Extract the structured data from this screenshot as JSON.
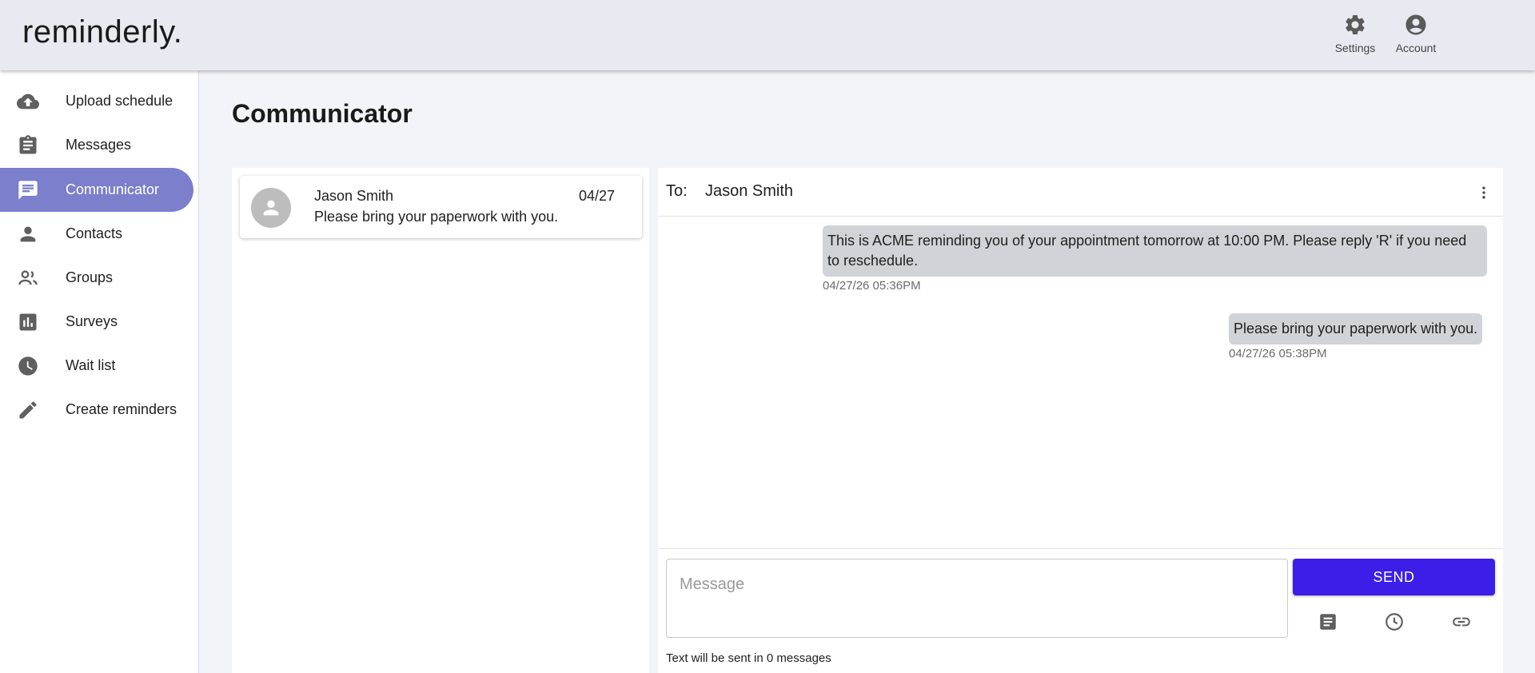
{
  "app": {
    "logo": "reminderly."
  },
  "header": {
    "settings_label": "Settings",
    "account_label": "Account"
  },
  "sidebar": {
    "items": [
      {
        "label": "Upload schedule",
        "icon": "cloud-upload-icon",
        "active": false
      },
      {
        "label": "Messages",
        "icon": "clipboard-icon",
        "active": false
      },
      {
        "label": "Communicator",
        "icon": "chat-icon",
        "active": true
      },
      {
        "label": "Contacts",
        "icon": "person-icon",
        "active": false
      },
      {
        "label": "Groups",
        "icon": "people-icon",
        "active": false
      },
      {
        "label": "Surveys",
        "icon": "bar-chart-icon",
        "active": false
      },
      {
        "label": "Wait list",
        "icon": "clock-icon",
        "active": false
      },
      {
        "label": "Create reminders",
        "icon": "pencil-icon",
        "active": false
      }
    ]
  },
  "page": {
    "title": "Communicator"
  },
  "conversations": [
    {
      "name": "Jason Smith",
      "date": "04/27",
      "preview": "Please bring your paperwork with you."
    }
  ],
  "chat": {
    "to_label": "To:",
    "recipient": "Jason Smith",
    "messages": [
      {
        "text": "This is ACME reminding you of your appointment tomorrow at 10:00 PM. Please reply 'R' if you need to reschedule.",
        "timestamp": "04/27/26 05:36PM"
      },
      {
        "text": "Please bring your paperwork with you.",
        "timestamp": "04/27/26 05:38PM"
      }
    ]
  },
  "composer": {
    "placeholder": "Message",
    "value": "",
    "send_label": "SEND",
    "sms_count_text": "Text will be sent in 0 messages",
    "tools": [
      "template-icon",
      "schedule-clock-icon",
      "link-icon"
    ]
  },
  "colors": {
    "accent": "#7b7fcc",
    "send_button": "#3d1de8",
    "bubble": "#d0d3d8",
    "header_bg": "#e8eaf1"
  }
}
